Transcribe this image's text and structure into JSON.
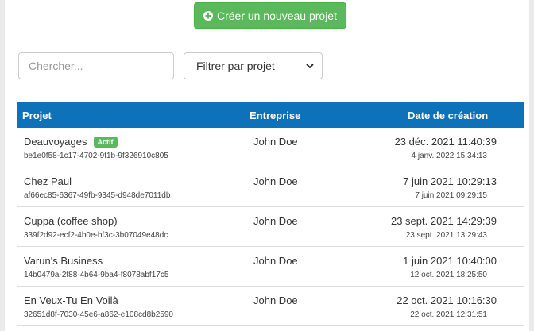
{
  "toolbar": {
    "create_label": "Créer un nouveau projet"
  },
  "search": {
    "placeholder": "Chercher..."
  },
  "filter": {
    "selected": "Filtrer par projet"
  },
  "table": {
    "headers": {
      "project": "Projet",
      "company": "Entreprise",
      "created": "Date de création"
    },
    "rows": [
      {
        "name": "Deauvoyages",
        "badge": "Actif",
        "uuid": "be1e0f58-1c17-4702-9f1b-9f326910c805",
        "company": "John Doe",
        "date": "23 déc. 2021 11:40:39",
        "subdate": "4 janv. 2022 15:34:13"
      },
      {
        "name": "Chez Paul",
        "badge": "",
        "uuid": "af66ec85-6367-49fb-9345-d948de7011db",
        "company": "John Doe",
        "date": "7 juin 2021 10:29:13",
        "subdate": "7 juin 2021 09:29:15"
      },
      {
        "name": "Cuppa (coffee shop)",
        "badge": "",
        "uuid": "339f2d92-ecf2-4b0e-bf3c-3b07049e48dc",
        "company": "John Doe",
        "date": "23 sept. 2021 14:29:39",
        "subdate": "23 sept. 2021 13:29:43"
      },
      {
        "name": "Varun's Business",
        "badge": "",
        "uuid": "14b0479a-2f88-4b64-9ba4-f8078abf17c5",
        "company": "John Doe",
        "date": "1 juin 2021 10:40:00",
        "subdate": "12 oct. 2021 18:25:50"
      },
      {
        "name": "En Veux-Tu En Voilà",
        "badge": "",
        "uuid": "32651d8f-7030-45e6-a862-e108cd8b2590",
        "company": "John Doe",
        "date": "22 oct. 2021 10:16:30",
        "subdate": "22 oct. 2021 12:31:51"
      }
    ]
  },
  "colors": {
    "accent_green": "#5cb85c",
    "header_blue": "#0d72b9",
    "page_bg": "#ebebeb"
  },
  "icons": {
    "create": "plus-circle-icon",
    "filter": "chevron-down-icon"
  }
}
